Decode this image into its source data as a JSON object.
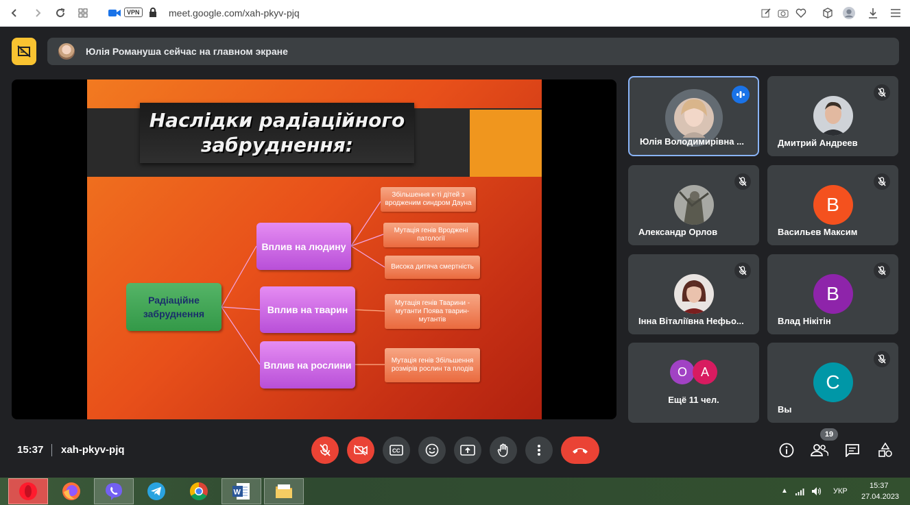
{
  "browser": {
    "url": "meet.google.com/xah-pkyv-pjq",
    "vpn_label": "VPN"
  },
  "banner": {
    "text": "Юлія Романуша сейчас на главном экране"
  },
  "slide": {
    "title": "Наслідки радіаційного забруднення:",
    "root": "Радіаційне забруднення",
    "branches": [
      {
        "label": "Вплив на людину",
        "leaves": [
          "Збільшення к-ті дітей з вродженим синдром Дауна",
          "Мутація генів Вроджені патології",
          "Висока дитяча смертність"
        ]
      },
      {
        "label": "Вплив на тварин",
        "leaves": [
          "Мутація генів Тварини - мутанти Поява тварин-мутантів"
        ]
      },
      {
        "label": "Вплив на рослини",
        "leaves": [
          "Мутація генів Збільшення розмірів рослин та плодів"
        ]
      }
    ]
  },
  "participants": [
    {
      "name": "Юлія Володимирівна ...",
      "speaking": true
    },
    {
      "name": "Дмитрий Андреев",
      "muted": true
    },
    {
      "name": "Александр Орлов",
      "muted": true
    },
    {
      "name": "Васильев Максим",
      "initial": "B",
      "color": "#f4511e",
      "muted": true
    },
    {
      "name": "Інна Віталіївна Нефьо...",
      "muted": true
    },
    {
      "name": "Влад Нікітін",
      "initial": "B",
      "color": "#8e24aa",
      "muted": true
    },
    {
      "name": "Ещё 11 чел.",
      "avatars": [
        {
          "initial": "O",
          "color": "#a142c4"
        },
        {
          "initial": "A",
          "color": "#d81b60"
        }
      ]
    },
    {
      "name": "Вы",
      "initial": "C",
      "color": "#0097a7",
      "muted": true
    }
  ],
  "footer": {
    "time": "15:37",
    "meeting_code": "xah-pkyv-pjq",
    "participants_count": "19"
  },
  "taskbar": {
    "language": "УКР",
    "clock_time": "15:37",
    "clock_date": "27.04.2023"
  },
  "colors": {
    "meet_bg": "#202124",
    "tile_bg": "#3c4043",
    "danger": "#ea4335",
    "active_border": "#8ab4f8"
  }
}
